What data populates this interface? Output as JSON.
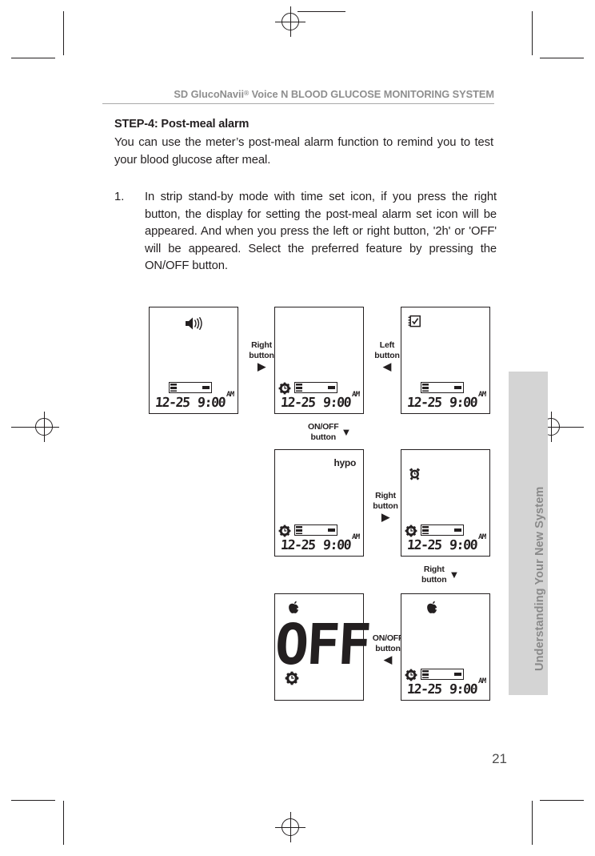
{
  "header": {
    "title_pre": "SD GlucoNavii",
    "title_reg": "®",
    "title_post": " Voice N BLOOD GLUCOSE MONITORING SYSTEM"
  },
  "side_tab": {
    "label": "Understanding Your New System"
  },
  "content": {
    "step_title": "STEP-4: Post-meal alarm",
    "intro": "You can use the meter’s post-meal alarm function to remind you to test your blood glucose after meal.",
    "list": [
      {
        "number": "1.",
        "text": "In strip stand-by mode with time set icon, if you press the right button, the display  for setting the post-meal alarm set icon will be appeared. And when you press the left or right button, '2h' or 'OFF' will be appeared. Select the preferred feature by pressing the ON/OFF button."
      }
    ]
  },
  "lcd_common": {
    "date": "12-25",
    "time": "9:00",
    "ampm": "AM"
  },
  "panels": [
    {
      "id": "panel-standby-speaker",
      "icons": [
        "speaker-icon",
        "strip-icon"
      ],
      "date": "12-25",
      "time": "9:00",
      "ampm": "AM"
    },
    {
      "id": "panel-timeset",
      "icons": [
        "gear-icon",
        "strip-icon"
      ],
      "date": "12-25",
      "time": "9:00",
      "ampm": "AM"
    },
    {
      "id": "panel-memory",
      "icons": [
        "memory-icon",
        "strip-icon"
      ],
      "date": "12-25",
      "time": "9:00",
      "ampm": "AM"
    },
    {
      "id": "panel-hypo",
      "icons": [
        "gear-icon",
        "strip-icon"
      ],
      "label": "hypo",
      "date": "12-25",
      "time": "9:00",
      "ampm": "AM"
    },
    {
      "id": "panel-alarm",
      "icons": [
        "alarm-clock-icon",
        "gear-icon",
        "strip-icon"
      ],
      "date": "12-25",
      "time": "9:00",
      "ampm": "AM"
    },
    {
      "id": "panel-off",
      "icons": [
        "apple-icon",
        "gear-icon"
      ],
      "value": "OFF"
    },
    {
      "id": "panel-postmeal",
      "icons": [
        "apple-icon",
        "gear-icon",
        "strip-icon"
      ],
      "date": "12-25",
      "time": "9:00",
      "ampm": "AM"
    }
  ],
  "flows": [
    {
      "id": "flow-right-1",
      "line1": "Right",
      "line2": "button",
      "arrow": "▶"
    },
    {
      "id": "flow-left-1",
      "line1": "Left",
      "line2": "button",
      "arrow": "◀"
    },
    {
      "id": "flow-onoff-1",
      "line1": "ON/OFF",
      "line2": "button",
      "arrow": "▼"
    },
    {
      "id": "flow-right-2",
      "line1": "Right",
      "line2": "button",
      "arrow": "▶"
    },
    {
      "id": "flow-right-3",
      "line1": "Right",
      "line2": "button",
      "arrow": "▼"
    },
    {
      "id": "flow-onoff-2",
      "line1": "ON/OFF",
      "line2": "button",
      "arrow": "◀"
    }
  ],
  "page": {
    "number": "21"
  }
}
